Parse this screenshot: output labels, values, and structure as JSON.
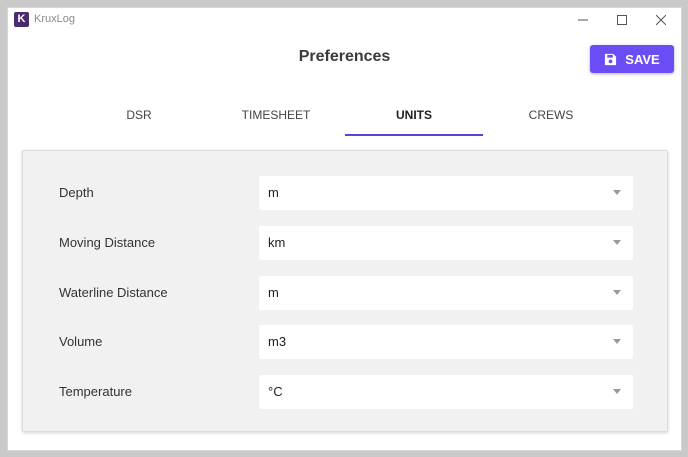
{
  "window": {
    "title": "KruxLog",
    "logo_letter": "K"
  },
  "header": {
    "title": "Preferences",
    "save_label": "SAVE"
  },
  "tabs": [
    {
      "label": "DSR",
      "active": false
    },
    {
      "label": "TIMESHEET",
      "active": false
    },
    {
      "label": "UNITS",
      "active": true
    },
    {
      "label": "CREWS",
      "active": false
    }
  ],
  "units": [
    {
      "label": "Depth",
      "value": "m"
    },
    {
      "label": "Moving Distance",
      "value": "km"
    },
    {
      "label": "Waterline Distance",
      "value": "m"
    },
    {
      "label": "Volume",
      "value": "m3"
    },
    {
      "label": "Temperature",
      "value": "°C"
    }
  ],
  "colors": {
    "accent": "#6c4df5",
    "tab_indicator": "#5b43d9",
    "logo_bg": "#4b2a6e"
  },
  "icons": {
    "save": "floppy-disk-icon",
    "select_caret": "caret-down-icon"
  }
}
